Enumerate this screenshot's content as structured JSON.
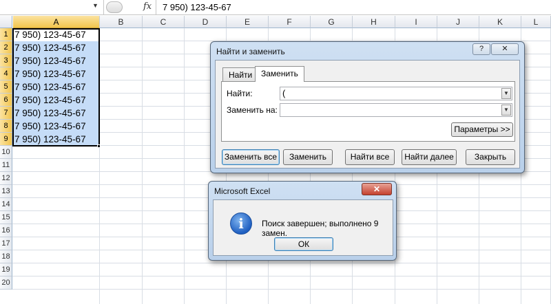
{
  "formula_bar": {
    "fx_label": "fx",
    "content": "7 950) 123-45-67"
  },
  "columns": [
    "A",
    "B",
    "C",
    "D",
    "E",
    "F",
    "G",
    "H",
    "I",
    "J",
    "K",
    "L"
  ],
  "rows": [
    "1",
    "2",
    "3",
    "4",
    "5",
    "6",
    "7",
    "8",
    "9",
    "10",
    "11",
    "12",
    "13",
    "14",
    "15",
    "16",
    "17",
    "18",
    "19",
    "20"
  ],
  "cells_a": [
    "7 950) 123-45-67",
    "7 950) 123-45-67",
    "7 950) 123-45-67",
    "7 950) 123-45-67",
    "7 950) 123-45-67",
    "7 950) 123-45-67",
    "7 950) 123-45-67",
    "7 950) 123-45-67",
    "7 950) 123-45-67"
  ],
  "find_replace": {
    "title": "Найти и заменить",
    "help_label": "?",
    "close_label": "✕",
    "tabs": [
      "Найти",
      "Заменить"
    ],
    "find_label": "Найти:",
    "find_value": "(",
    "replace_label": "Заменить на:",
    "replace_value": "",
    "options_button": "Параметры >>",
    "buttons": {
      "replace_all": "Заменить все",
      "replace": "Заменить",
      "find_all": "Найти все",
      "find_next": "Найти далее",
      "close": "Закрыть"
    }
  },
  "message_box": {
    "title": "Microsoft Excel",
    "close_label": "✕",
    "message": "Поиск завершен; выполнено 9 замен.",
    "ok_label": "ОК"
  }
}
